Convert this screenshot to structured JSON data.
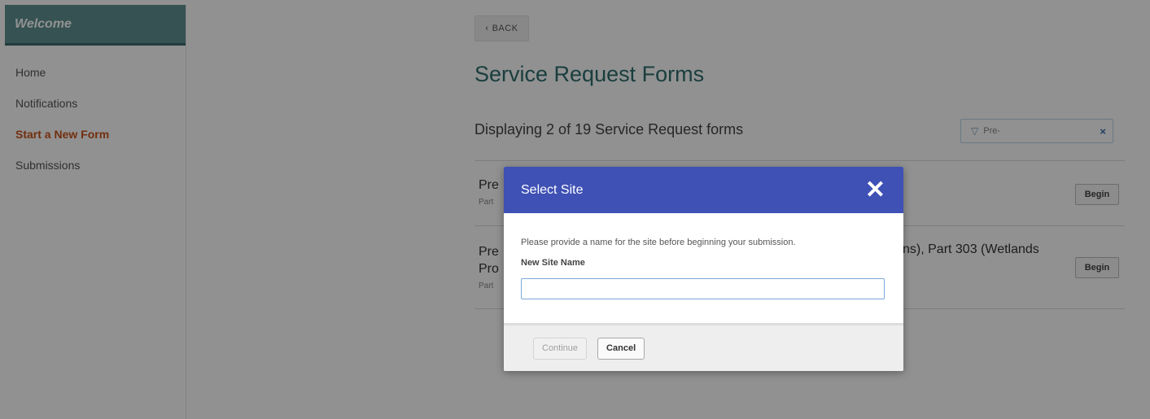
{
  "sidebar": {
    "header": "Welcome",
    "items": [
      {
        "label": "Home",
        "active": false
      },
      {
        "label": "Notifications",
        "active": false
      },
      {
        "label": "Start a New Form",
        "active": true
      },
      {
        "label": "Submissions",
        "active": false
      }
    ]
  },
  "main": {
    "back_label": "BACK",
    "page_title": "Service Request Forms",
    "display_count": "Displaying 2 of 19 Service Request forms",
    "filter": {
      "value": "Pre-",
      "clear": "×"
    },
    "rows": [
      {
        "title_visible": "Pre",
        "sub_visible": "Part",
        "begin_label": "Begin"
      },
      {
        "title_line1": "Pre",
        "title_line2": "Pro",
        "title_tail": "ns), Part 303 (Wetlands",
        "sub_visible": "Part",
        "begin_label": "Begin"
      }
    ]
  },
  "modal": {
    "title": "Select Site",
    "close": "✕",
    "description": "Please provide a name for the site before beginning your submission.",
    "field_label": "New Site Name",
    "field_value": "",
    "continue_label": "Continue",
    "cancel_label": "Cancel"
  },
  "colors": {
    "sidebar_header": "#5f9190",
    "active_nav": "#c8531a",
    "title_teal": "#2f6e6d",
    "modal_header": "#3f51b5"
  }
}
